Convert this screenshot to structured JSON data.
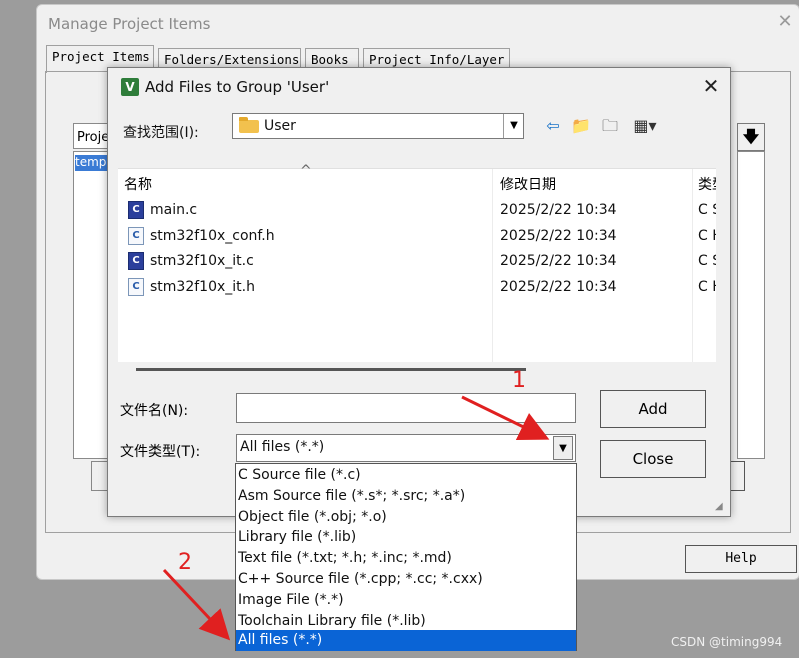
{
  "outer_window": {
    "title": "Manage Project Items",
    "tabs": [
      "Project Items",
      "Folders/Extensions",
      "Books",
      "Project Info/Layer"
    ],
    "group_header": "Project",
    "group_item": "template",
    "help_label": "Help"
  },
  "dialog": {
    "title": "Add Files to Group 'User'",
    "look_in_label": "查找范围(I):",
    "look_in_value": "User",
    "columns": {
      "name": "名称",
      "date": "修改日期",
      "type": "类型"
    },
    "files": [
      {
        "name": "main.c",
        "date": "2025/2/22 10:34",
        "type": "C Source file",
        "icon": "c-source-app-icon"
      },
      {
        "name": "stm32f10x_conf.h",
        "date": "2025/2/22 10:34",
        "type": "C Header file",
        "icon": "c-header-icon"
      },
      {
        "name": "stm32f10x_it.c",
        "date": "2025/2/22 10:34",
        "type": "C Source file",
        "icon": "c-source-app-icon"
      },
      {
        "name": "stm32f10x_it.h",
        "date": "2025/2/22 10:34",
        "type": "C Header file",
        "icon": "c-header-icon"
      }
    ],
    "filename_label": "文件名(N):",
    "filename_value": "",
    "filetype_label": "文件类型(T):",
    "filetype_value": "All files (*.*)",
    "add_label": "Add",
    "close_label": "Close"
  },
  "dropdown_options": [
    "C Source file (*.c)",
    "Asm Source file (*.s*; *.src; *.a*)",
    "Object file (*.obj; *.o)",
    "Library file (*.lib)",
    "Text file (*.txt; *.h; *.inc; *.md)",
    "C++ Source file (*.cpp; *.cc; *.cxx)",
    "Image File (*.*)",
    "Toolchain Library file (*.lib)",
    "All files (*.*)"
  ],
  "dropdown_selected_index": 8,
  "annotations": {
    "step1": "1",
    "step2": "2",
    "color": "#e02020"
  },
  "watermark": "CSDN @timing994"
}
